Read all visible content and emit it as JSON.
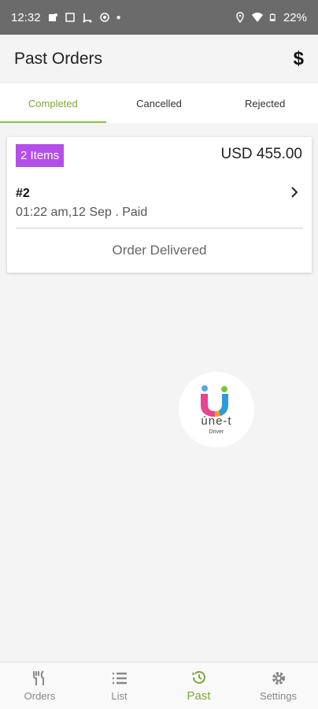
{
  "status_bar": {
    "time": "12:32",
    "battery": "22%"
  },
  "app_bar": {
    "title": "Past Orders",
    "currency_symbol": "$"
  },
  "tabs": [
    {
      "label": "Completed",
      "active": true
    },
    {
      "label": "Cancelled",
      "active": false
    },
    {
      "label": "Rejected",
      "active": false
    }
  ],
  "order": {
    "items_badge": "2 Items",
    "amount": "USD 455.00",
    "number": "#2",
    "meta": "01:22 am,12 Sep . Paid",
    "status": "Order Delivered"
  },
  "logo": {
    "brand": "úne-t",
    "sub": "Driver"
  },
  "bottom_nav": [
    {
      "label": "Orders",
      "icon": "cutlery-icon",
      "active": false
    },
    {
      "label": "List",
      "icon": "list-icon",
      "active": false
    },
    {
      "label": "Past",
      "icon": "history-icon",
      "active": true
    },
    {
      "label": "Settings",
      "icon": "gear-icon",
      "active": false
    }
  ],
  "colors": {
    "accent": "#8cbf4a",
    "badge": "#b34ee8",
    "status_bar": "#6b6b6b"
  }
}
